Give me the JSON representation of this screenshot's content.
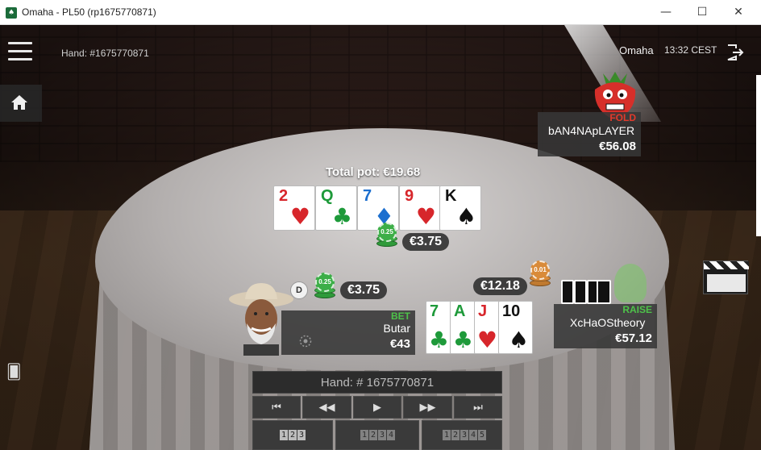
{
  "window": {
    "title": "Omaha - PL50 (rp1675770871)",
    "app_icon": "app-icon",
    "minimize": "—",
    "maximize": "☐",
    "close": "✕"
  },
  "header": {
    "hand_label": "Hand: #1675770871",
    "game": "Omaha",
    "clock": "13:32 CEST"
  },
  "pot": {
    "total": "Total pot: €19.68",
    "main_bet": "€3.75",
    "main_chip": "0.25"
  },
  "board": [
    {
      "rank": "2",
      "suit": "♥",
      "color": "red"
    },
    {
      "rank": "Q",
      "suit": "♣",
      "color": "green"
    },
    {
      "rank": "7",
      "suit": "♦",
      "color": "blue"
    },
    {
      "rank": "9",
      "suit": "♥",
      "color": "red"
    },
    {
      "rank": "K",
      "suit": "♠",
      "color": "black"
    }
  ],
  "players": {
    "top_right": {
      "action": "FOLD",
      "name": "bAN4NApLAYER",
      "stack": "€56.08",
      "action_color": "#e23a2c"
    },
    "hero": {
      "action": "BET",
      "name": "Butar",
      "stack": "€43",
      "bet": "€3.75",
      "chip": "0.25",
      "action_color": "#4ec24a",
      "dealer": "D"
    },
    "right": {
      "action": "RAISE",
      "name": "XcHaOStheory",
      "stack": "€57.12",
      "bet": "€12.18",
      "chip": "0.01",
      "action_color": "#4ec24a"
    }
  },
  "hero_cards": [
    {
      "rank": "7",
      "suit": "♣",
      "color": "green"
    },
    {
      "rank": "A",
      "suit": "♣",
      "color": "green"
    },
    {
      "rank": "J",
      "suit": "♥",
      "color": "red"
    },
    {
      "rank": "10",
      "suit": "♠",
      "color": "black"
    }
  ],
  "replayer": {
    "hand_title": "Hand: # 1675770871",
    "controls": [
      "⏮",
      "◀◀",
      "▶",
      "▶▶",
      "⏭"
    ],
    "seat_buttons": [
      [
        "1",
        "2",
        "3"
      ],
      [
        "1",
        "2",
        "3",
        "4"
      ],
      [
        "1",
        "2",
        "3",
        "4",
        "5"
      ]
    ]
  }
}
